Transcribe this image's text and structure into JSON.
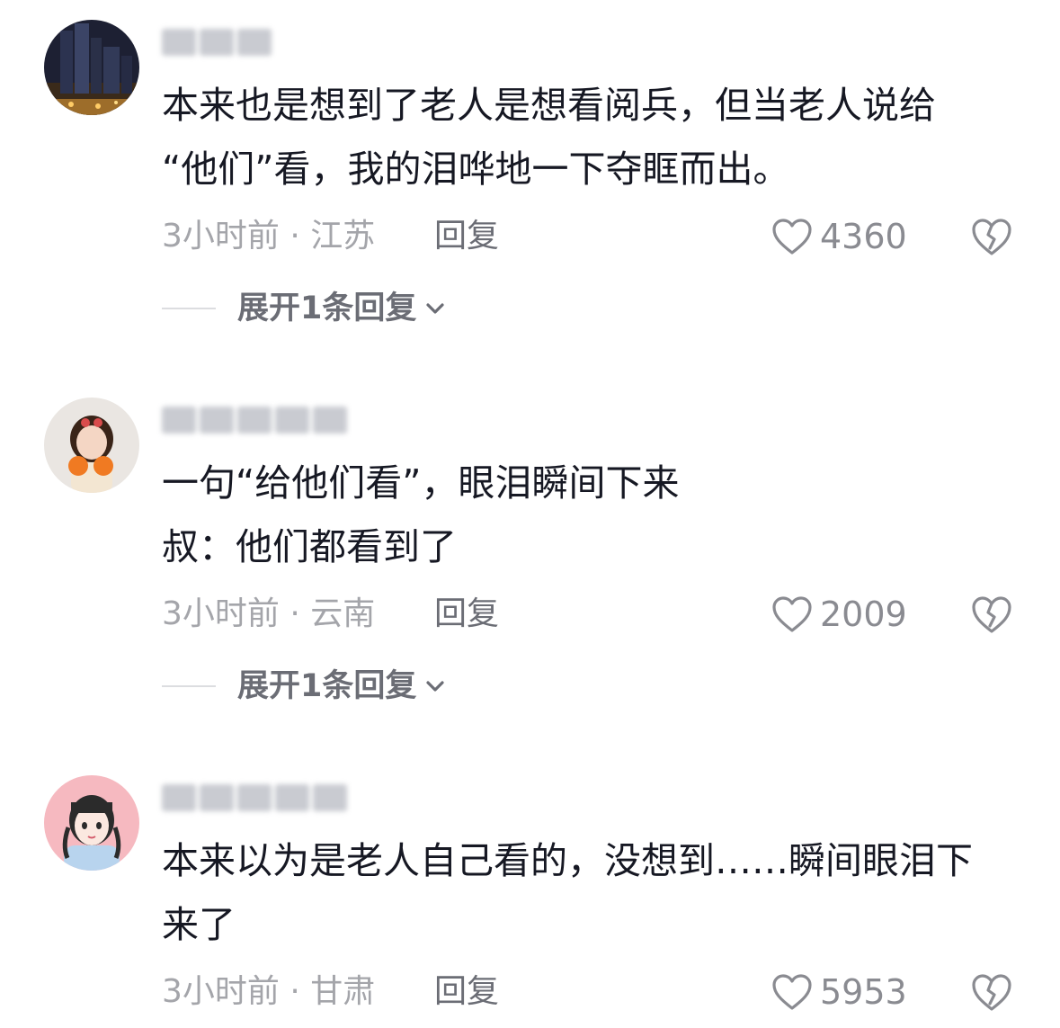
{
  "colors": {
    "text_primary": "#161823",
    "text_meta": "#a4a5aa",
    "text_action": "#6b6d75",
    "icon_stroke": "#8a8b91"
  },
  "comments": [
    {
      "avatar": "city-night-avatar",
      "text": "本来也是想到了老人是想看阅兵，但当老人说给\n“他们”看，我的泪哗地一下夺眶而出。",
      "meta": "3小时前 · 江苏",
      "reply_label": "回复",
      "likes": "4360",
      "expand_label": "展开1条回复"
    },
    {
      "avatar": "girl-with-oranges-avatar",
      "text": "一句“给他们看”，眼泪瞬间下来\n叔：他们都看到了",
      "meta": "3小时前 · 云南",
      "reply_label": "回复",
      "likes": "2009",
      "expand_label": "展开1条回复"
    },
    {
      "avatar": "cartoon-girl-avatar",
      "text": "本来以为是老人自己看的，没想到……瞬间眼泪下\n来了",
      "meta": "3小时前 · 甘肃",
      "reply_label": "回复",
      "likes": "5953"
    }
  ]
}
